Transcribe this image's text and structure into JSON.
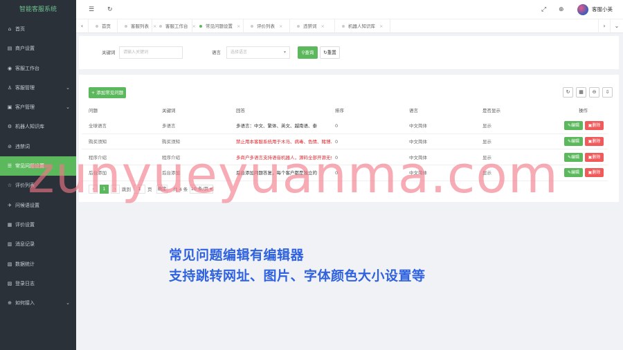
{
  "app": {
    "brand": "智能客服系统"
  },
  "sidebar": {
    "items": [
      {
        "icon": "⌂",
        "label": "首页",
        "chevron": false
      },
      {
        "icon": "▤",
        "label": "商户设置",
        "chevron": false
      },
      {
        "icon": "◉",
        "label": "客服工作台",
        "chevron": false
      },
      {
        "icon": "♙",
        "label": "客服管理",
        "chevron": true
      },
      {
        "icon": "▣",
        "label": "客户管理",
        "chevron": true
      },
      {
        "icon": "⚙",
        "label": "机器人知识库",
        "chevron": false
      },
      {
        "icon": "⊘",
        "label": "违禁词",
        "chevron": false
      },
      {
        "icon": "☰",
        "label": "常见问题设置",
        "chevron": false
      },
      {
        "icon": "☆",
        "label": "评价列表",
        "chevron": false
      },
      {
        "icon": "✈",
        "label": "问候语设置",
        "chevron": false
      },
      {
        "icon": "▦",
        "label": "评价设置",
        "chevron": false
      },
      {
        "icon": "▥",
        "label": "消息记录",
        "chevron": false
      },
      {
        "icon": "▧",
        "label": "数据统计",
        "chevron": false
      },
      {
        "icon": "▨",
        "label": "登录日志",
        "chevron": false
      },
      {
        "icon": "⊕",
        "label": "如何接入",
        "chevron": true
      }
    ]
  },
  "topbar": {
    "menu_icon": "☰",
    "refresh_icon": "↻",
    "fullscreen_icon": "⤢",
    "globe_icon": "⊕",
    "username": "客服小美"
  },
  "tabs": {
    "left_arrow": "‹",
    "right_arrow": "›",
    "close_icon": "⌄",
    "close_mark": "×",
    "items": [
      {
        "label": "首页"
      },
      {
        "label": "客服列表"
      },
      {
        "label": "客服工作台"
      },
      {
        "label": "常见问题设置"
      },
      {
        "label": "评价列表"
      },
      {
        "label": "违禁词"
      },
      {
        "label": "机器人知识库"
      }
    ]
  },
  "search": {
    "keyword_label": "关键词",
    "keyword_placeholder": "请输入关键词",
    "lang_label": "语言",
    "lang_placeholder": "选择语言",
    "query_label": "查询",
    "reset_label": "重置"
  },
  "toolbar": {
    "add_label": "+ 添加常见问题"
  },
  "table": {
    "headers": [
      "问题",
      "关键词",
      "回答",
      "排序",
      "语言",
      "是否显示",
      "操作"
    ],
    "edit_label": "✎编辑",
    "delete_label": "▣删除",
    "rows": [
      {
        "question": "全球语言",
        "keyword": "多语言",
        "answer": "多语言：中文、繁体、英文、越南语、泰",
        "sort": "0",
        "lang": "中文简体",
        "show": "显示",
        "answer_red": false
      },
      {
        "question": "购买须知",
        "keyword": "购买须知",
        "answer": "禁止用本客服系统用于木马、病毒、色情、赌博、",
        "sort": "0",
        "lang": "中文简体",
        "show": "显示",
        "answer_red": true
      },
      {
        "question": "程序介绍",
        "keyword": "程序介绍",
        "answer": "多商户多语言支持语音机器人，源码全部开源无任",
        "sort": "0",
        "lang": "中文简体",
        "show": "显示",
        "answer_red": true
      },
      {
        "question": "后台添加",
        "keyword": "后台添加",
        "answer": "后台添加问题答复，每个客户都是独立的",
        "sort": "0",
        "lang": "中文简体",
        "show": "显示",
        "answer_red": false
      }
    ]
  },
  "pagination": {
    "prev": "‹",
    "current": "1",
    "next": "›",
    "goto_label": "跳到",
    "page_input": "1",
    "page_unit": "页",
    "confirm": "确定",
    "total": "共 4 条",
    "page_size": "10 条/页"
  },
  "overlay": {
    "caption_line1": "常见问题编辑有编辑器",
    "caption_line2": "支持跳转网址、图片、字体颜色大小设置等",
    "watermark": "zunyueyuanma.com"
  },
  "colors": {
    "accent": "#5cb85c",
    "danger": "#ef5a5a",
    "sidebar_bg": "#2a3139",
    "caption": "#2f62e0"
  }
}
